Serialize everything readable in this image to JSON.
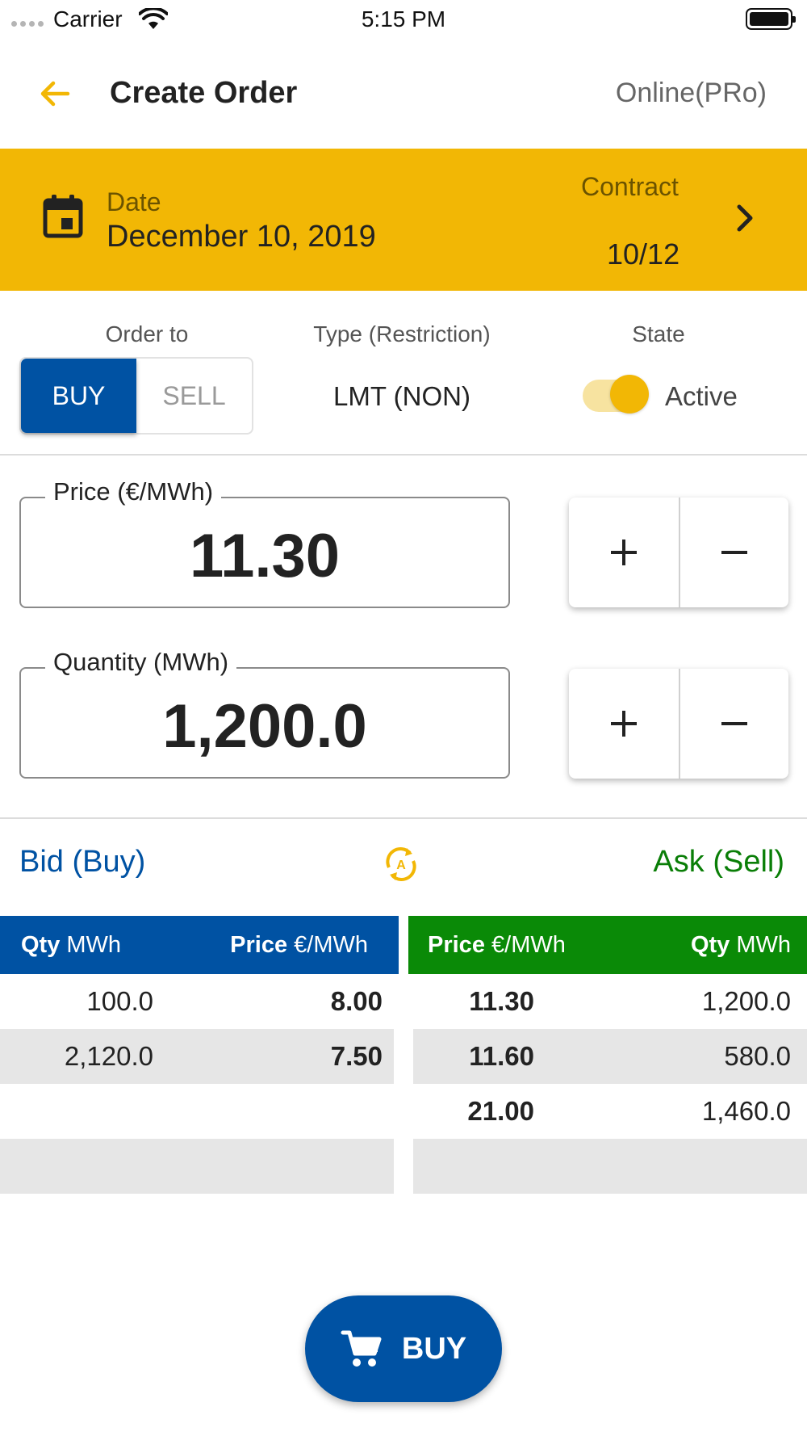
{
  "status_bar": {
    "carrier": "Carrier",
    "time": "5:15 PM"
  },
  "header": {
    "title": "Create Order",
    "connection_status": "Online(PRo)"
  },
  "banner": {
    "date_label": "Date",
    "date_value": "December 10, 2019",
    "contract_label": "Contract",
    "contract_value": "10/12"
  },
  "order_settings": {
    "order_to_label": "Order to",
    "buy_label": "BUY",
    "sell_label": "SELL",
    "selected_side": "BUY",
    "type_label": "Type (Restriction)",
    "type_value": "LMT (NON)",
    "state_label": "State",
    "state_value": "Active",
    "state_on": true
  },
  "fields": {
    "price_label": "Price (€/MWh)",
    "price_value": "11.30",
    "quantity_label": "Quantity (MWh)",
    "quantity_value": "1,200.0",
    "plus_symbol": "+",
    "minus_symbol": "−"
  },
  "order_book": {
    "bid_title": "Bid (Buy)",
    "ask_title": "Ask (Sell)",
    "bid_headers": {
      "qty_bold": "Qty",
      "qty_unit": " MWh",
      "price_bold": "Price",
      "price_unit": " €/MWh"
    },
    "ask_headers": {
      "price_bold": "Price",
      "price_unit": " €/MWh",
      "qty_bold": "Qty",
      "qty_unit": " MWh"
    },
    "bid_rows": [
      {
        "qty": "100.0",
        "price": "8.00"
      },
      {
        "qty": "2,120.0",
        "price": "7.50"
      },
      {
        "qty": "",
        "price": ""
      },
      {
        "qty": "",
        "price": ""
      }
    ],
    "ask_rows": [
      {
        "price": "11.30",
        "qty": "1,200.0"
      },
      {
        "price": "11.60",
        "qty": "580.0"
      },
      {
        "price": "21.00",
        "qty": "1,460.0"
      },
      {
        "price": "",
        "qty": ""
      }
    ]
  },
  "actions": {
    "submit_label": "BUY"
  },
  "colors": {
    "accent_yellow": "#f2b705",
    "buy_blue": "#0052a3",
    "sell_green": "#0a8a07"
  },
  "icons": [
    "back-arrow-icon",
    "calendar-icon",
    "chevron-right-icon",
    "auto-refresh-icon",
    "cart-icon",
    "wifi-icon",
    "battery-icon"
  ]
}
